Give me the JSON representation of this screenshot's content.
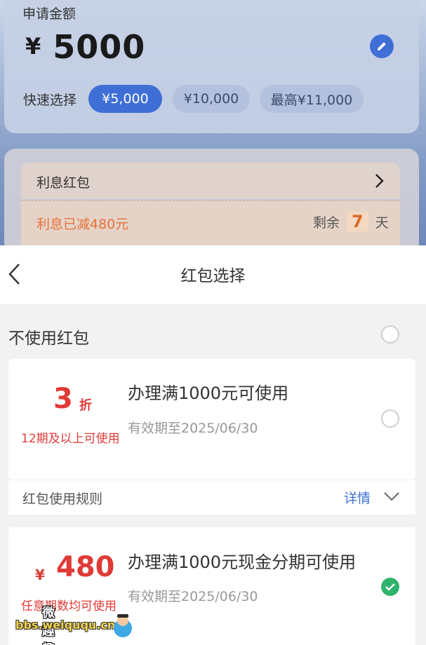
{
  "loan": {
    "title": "申请金额",
    "currency": "¥",
    "amount": "5000",
    "quick_label": "快速选择",
    "chips": [
      "¥5,000",
      "¥10,000",
      "最高¥11,000"
    ],
    "accent": "#3f6fd6"
  },
  "coupon_summary": {
    "label": "利息红包",
    "saved": "利息已减480元",
    "remain_prefix": "剩余",
    "remain_days": "7",
    "remain_suffix": "天"
  },
  "sheet": {
    "title": "红包选择",
    "no_coupon_label": "不使用红包",
    "cards": [
      {
        "value": "3",
        "unit": "折",
        "condition": "12期及以上可使用",
        "title": "办理满1000元可使用",
        "valid_until": "有效期至2025/06/30",
        "selected": false,
        "rules_label": "红包使用规则",
        "details_label": "详情"
      },
      {
        "currency": "¥",
        "value": "480",
        "condition": "任意期数均可使用",
        "title": "办理满1000元现金分期可使用",
        "valid_until": "有效期至2025/06/30",
        "selected": true
      }
    ]
  },
  "watermark": {
    "top": "微趣趣",
    "bottom": "bbs.weiququ.cn"
  }
}
